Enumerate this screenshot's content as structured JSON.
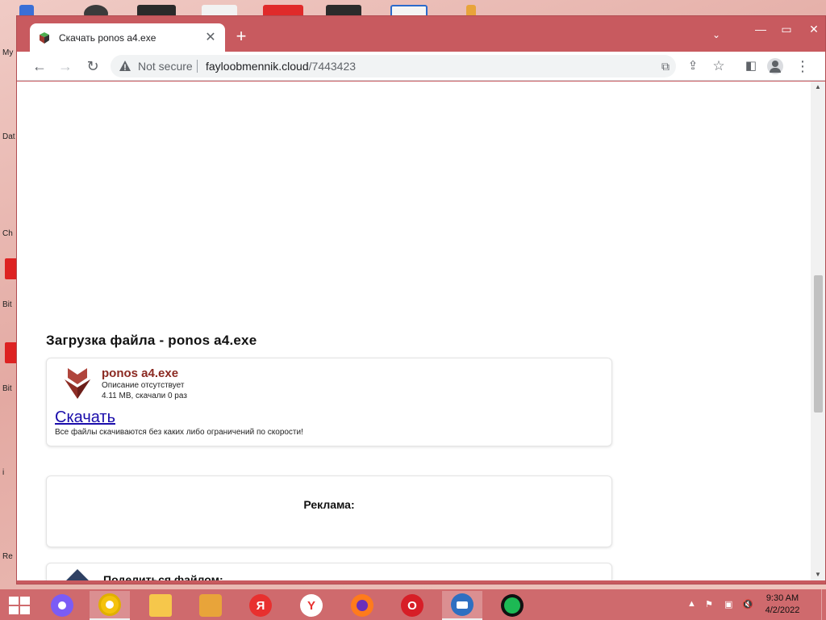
{
  "desktop": {
    "labels": [
      "My",
      "Dat",
      "Ch",
      "Bit",
      "Bit",
      "i",
      "Re"
    ]
  },
  "browser": {
    "tab": {
      "title": "Скачать ponos a4.exe"
    },
    "omnibox": {
      "security": "Not secure",
      "host": "fayloobmennik.cloud",
      "path": "/7443423"
    }
  },
  "page": {
    "title": "Загрузка файла - ponos a4.exe",
    "file": {
      "name": "ponos a4.exe",
      "description": "Описание отсутствует",
      "meta": "4.11 MB, скачали 0 раз",
      "download_label": "Скачать",
      "notice": "Все файлы скачиваются без каких либо ограничений по скорости!"
    },
    "ad_label": "Реклама:",
    "share_label": "Поделиться файлом:"
  },
  "taskbar": {
    "apps": [
      {
        "name": "alice",
        "glyph": "",
        "color": "#7b5cf5"
      },
      {
        "name": "chrome",
        "glyph": "",
        "color": "#f4c20d"
      },
      {
        "name": "explorer",
        "glyph": "",
        "color": "#f6c74b"
      },
      {
        "name": "announcer",
        "glyph": "",
        "color": "#e8a43a"
      },
      {
        "name": "yandex",
        "glyph": "Я",
        "color": "#e8302f"
      },
      {
        "name": "yandex-browser",
        "glyph": "Y",
        "color": "#ffffff"
      },
      {
        "name": "firefox",
        "glyph": "",
        "color": "#ff7b1c"
      },
      {
        "name": "opera",
        "glyph": "O",
        "color": "#d71e27"
      },
      {
        "name": "thunderbird",
        "glyph": "",
        "color": "#2e6fc1"
      },
      {
        "name": "spotify",
        "glyph": "",
        "color": "#1db954"
      }
    ],
    "time": "9:30 AM",
    "date": "4/2/2022"
  },
  "colors": {
    "window_frame": "#c85a5f",
    "taskbar": "#cf6a6d",
    "file_name": "#8b2a22",
    "link": "#1a0dab"
  }
}
